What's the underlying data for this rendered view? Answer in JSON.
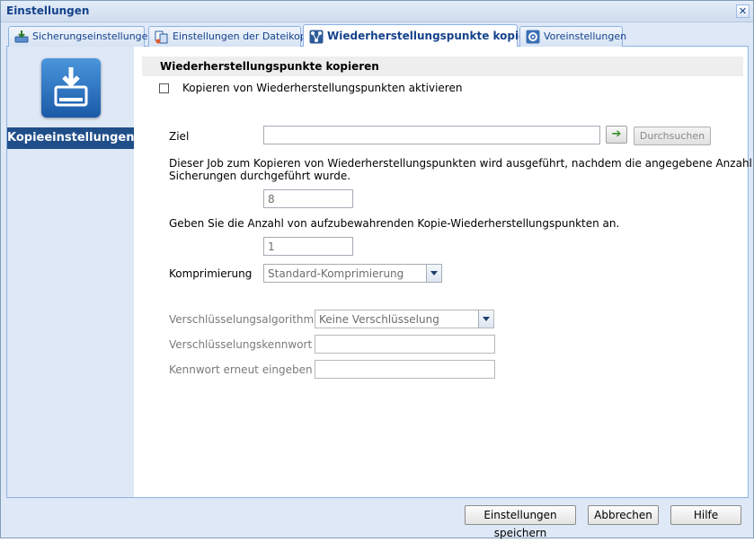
{
  "window": {
    "title": "Einstellungen",
    "close_glyph": "✕"
  },
  "tabs": [
    {
      "label": "Sicherungseinstellungen",
      "icon": "backup-settings-icon",
      "active": false
    },
    {
      "label": "Einstellungen der Dateikopie",
      "icon": "file-copy-icon",
      "active": false
    },
    {
      "label": "Wiederherstellungspunkte kopieren",
      "icon": "recovery-points-copy-icon",
      "active": true
    },
    {
      "label": "Voreinstellungen",
      "icon": "preferences-gear-icon",
      "active": false
    }
  ],
  "sidebar": {
    "label": "Kopieeinstellungen",
    "icon": "copy-drive-icon"
  },
  "section": {
    "title": "Wiederherstellungspunkte kopieren",
    "enable_label": "Kopieren von Wiederherstellungspunkten aktivieren",
    "enable_checked": false
  },
  "form": {
    "ziel_label": "Ziel",
    "ziel_value": "",
    "go_glyph": "➔",
    "browse_label": "Durchsuchen",
    "job_desc": "Dieser Job zum Kopieren von Wiederherstellungspunkten wird ausgeführt, nachdem die angegebene Anzahl von",
    "job_desc2": "Sicherungen durchgeführt wurde.",
    "job_count": "8",
    "keep_desc": "Geben Sie die Anzahl von aufzubewahrenden Kopie-Wiederherstellungspunkten an.",
    "keep_count": "1",
    "compression_label": "Komprimierung",
    "compression_value": "Standard-Komprimierung",
    "encryption_algo_label": "Verschlüsselungsalgorithmus",
    "encryption_algo_value": "Keine Verschlüsselung",
    "encryption_pw_label": "Verschlüsselungskennwort",
    "encryption_pw_value": "",
    "encryption_pw2_label": "Kennwort erneut eingeben",
    "encryption_pw2_value": ""
  },
  "footer": {
    "save_label": "Einstellungen speichern",
    "cancel_label": "Abbrechen",
    "help_label": "Hilfe"
  },
  "colors": {
    "accent_dark": "#1f4e89",
    "tab_text": "#15428b",
    "frame": "#dfe8f6"
  }
}
